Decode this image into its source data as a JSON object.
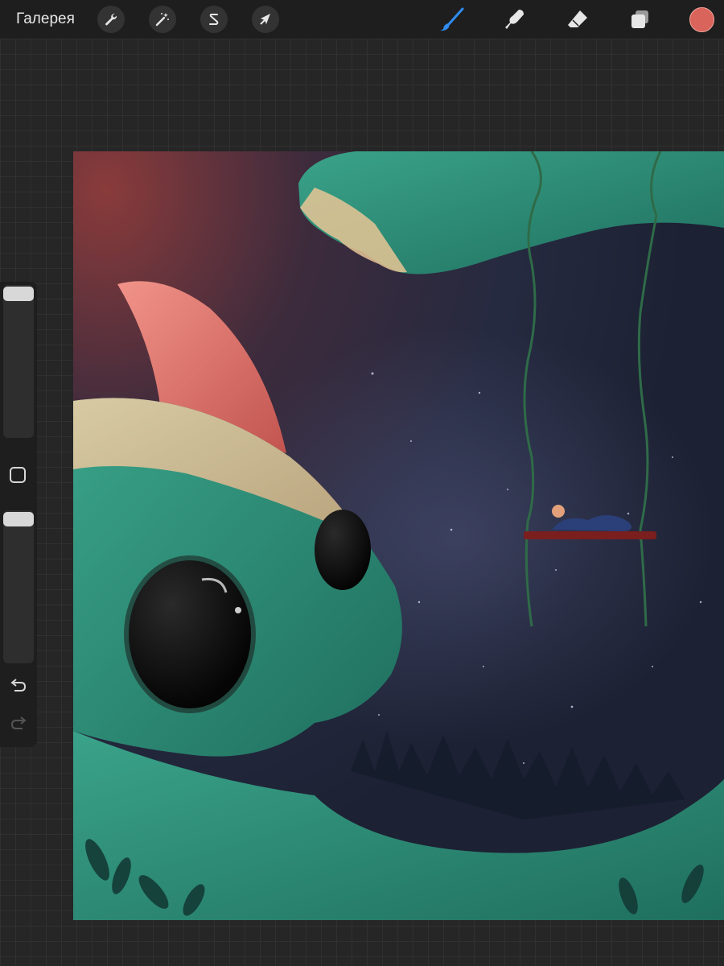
{
  "topbar": {
    "gallery_label": "Галерея",
    "left_tools": [
      {
        "name": "actions",
        "icon": "wrench-icon"
      },
      {
        "name": "adjustments",
        "icon": "magic-wand-icon"
      },
      {
        "name": "selection",
        "icon": "selection-s-icon"
      },
      {
        "name": "transform",
        "icon": "arrow-cursor-icon"
      }
    ],
    "right_tools": [
      {
        "name": "brush",
        "icon": "brush-icon",
        "active": true,
        "color": "#2f8cf0"
      },
      {
        "name": "smudge",
        "icon": "smudge-finger-icon",
        "active": false
      },
      {
        "name": "eraser",
        "icon": "eraser-icon",
        "active": false
      },
      {
        "name": "layers",
        "icon": "layers-icon",
        "active": false
      }
    ],
    "current_color": "#d9645b"
  },
  "sidebar": {
    "brush_size_level": 0.0,
    "opacity_level": 0.0,
    "modify_icon": "square-icon",
    "undo_icon": "undo-icon",
    "redo_icon": "redo-icon",
    "redo_enabled": false
  },
  "artwork": {
    "description_colors": {
      "sky_dark": "#1e2236",
      "sky_red": "#8a3b3b",
      "monster_green": "#2e8f78",
      "fur_cream": "#e8c9a0",
      "horn_pink": "#d9736b"
    }
  }
}
